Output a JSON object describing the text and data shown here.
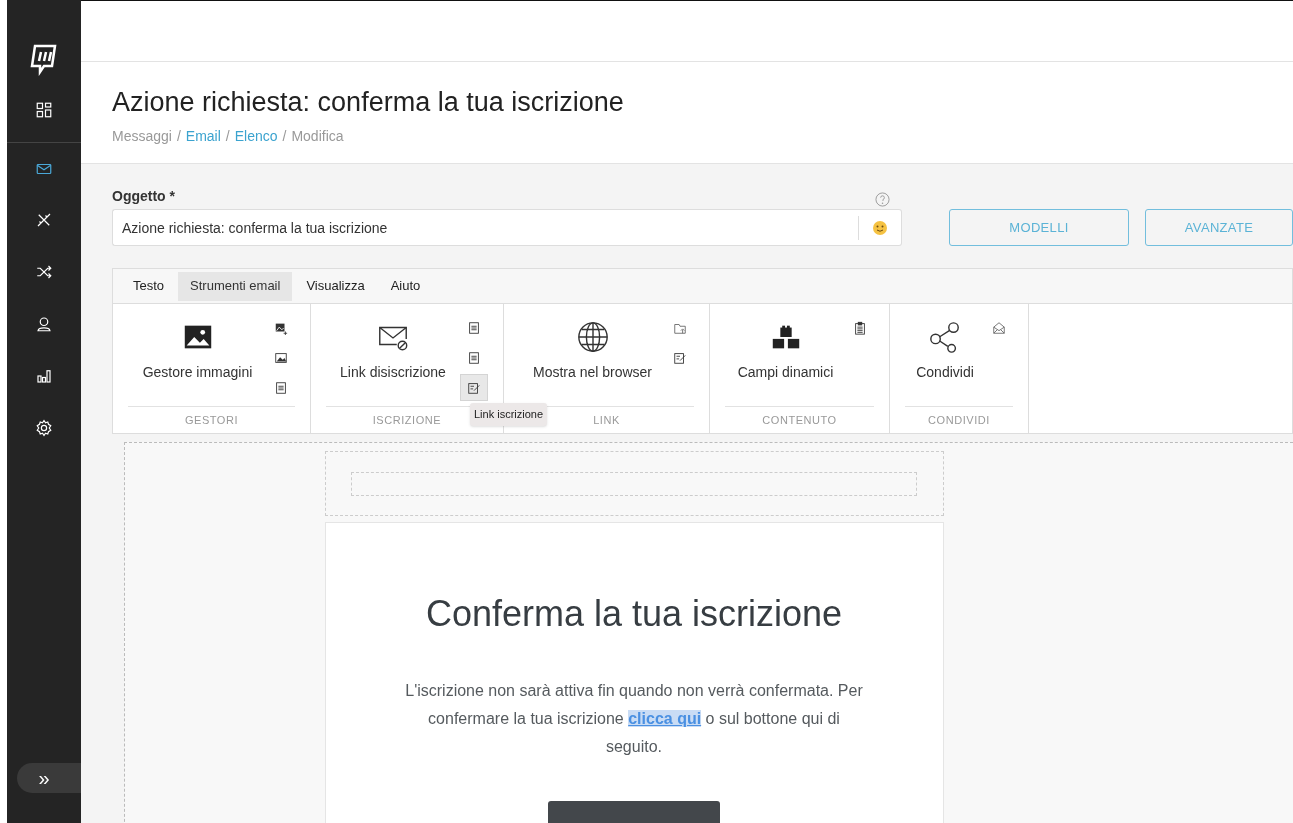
{
  "sidebar": {
    "items": [
      {
        "kind": "dashboard",
        "selected": false
      },
      {
        "kind": "mail",
        "selected": true
      },
      {
        "kind": "tools",
        "selected": false
      },
      {
        "kind": "shuffle",
        "selected": false
      },
      {
        "kind": "user",
        "selected": false
      },
      {
        "kind": "chart",
        "selected": false
      },
      {
        "kind": "settings",
        "selected": false
      }
    ],
    "expand_button": "»"
  },
  "page": {
    "title": "Azione richiesta: conferma la tua iscrizione",
    "breadcrumb_separator": "/",
    "breadcrumb": [
      {
        "label": "Messaggi",
        "link": false
      },
      {
        "label": "Email",
        "link": true
      },
      {
        "label": "Elenco",
        "link": true
      },
      {
        "label": "Modifica",
        "link": false
      }
    ]
  },
  "subject": {
    "label": "Oggetto *",
    "value": "Azione richiesta: conferma la tua iscrizione"
  },
  "buttons": [
    "MODELLI",
    "AVANZATE"
  ],
  "ribbon": {
    "tabs": [
      {
        "label": "Testo",
        "selected": false
      },
      {
        "label": "Strumenti email",
        "selected": true
      },
      {
        "label": "Visualizza",
        "selected": false
      },
      {
        "label": "Aiuto",
        "selected": false
      }
    ],
    "groups": [
      {
        "label": "GESTORI",
        "button": {
          "kind": "image",
          "label": "Gestore immagini"
        },
        "small": [
          {
            "kind": "image-add",
            "selected": false
          },
          {
            "kind": "image",
            "selected": false
          },
          {
            "kind": "doc",
            "selected": false
          }
        ]
      },
      {
        "label": "ISCRIZIONE",
        "button": {
          "kind": "mail-block",
          "label": "Link disiscrizione"
        },
        "small": [
          {
            "kind": "doc",
            "selected": false
          },
          {
            "kind": "doc",
            "selected": false
          },
          {
            "kind": "edit",
            "selected": true,
            "tooltip": "Link iscrizione"
          }
        ]
      },
      {
        "label": "LINK",
        "button": {
          "kind": "globe",
          "label": "Mostra nel browser"
        },
        "small": [
          {
            "kind": "folder",
            "selected": false
          },
          {
            "kind": "edit",
            "selected": false
          }
        ]
      },
      {
        "label": "CONTENUTO",
        "button": {
          "kind": "blocks",
          "label": "Campi dinamici"
        },
        "small": [
          {
            "kind": "clipboard",
            "selected": false
          }
        ]
      },
      {
        "label": "CONDIVIDI",
        "button": {
          "kind": "share",
          "label": "Condividi"
        },
        "small": [
          {
            "kind": "mail",
            "selected": false
          }
        ]
      }
    ]
  },
  "email": {
    "heading": "Conferma la tua iscrizione",
    "text_before": "L'iscrizione non sarà attiva fin quando non verrà confermata. Per confermare la tua iscrizione",
    "link": "clicca qui",
    "text_after": "o sul bottone qui di seguito."
  }
}
